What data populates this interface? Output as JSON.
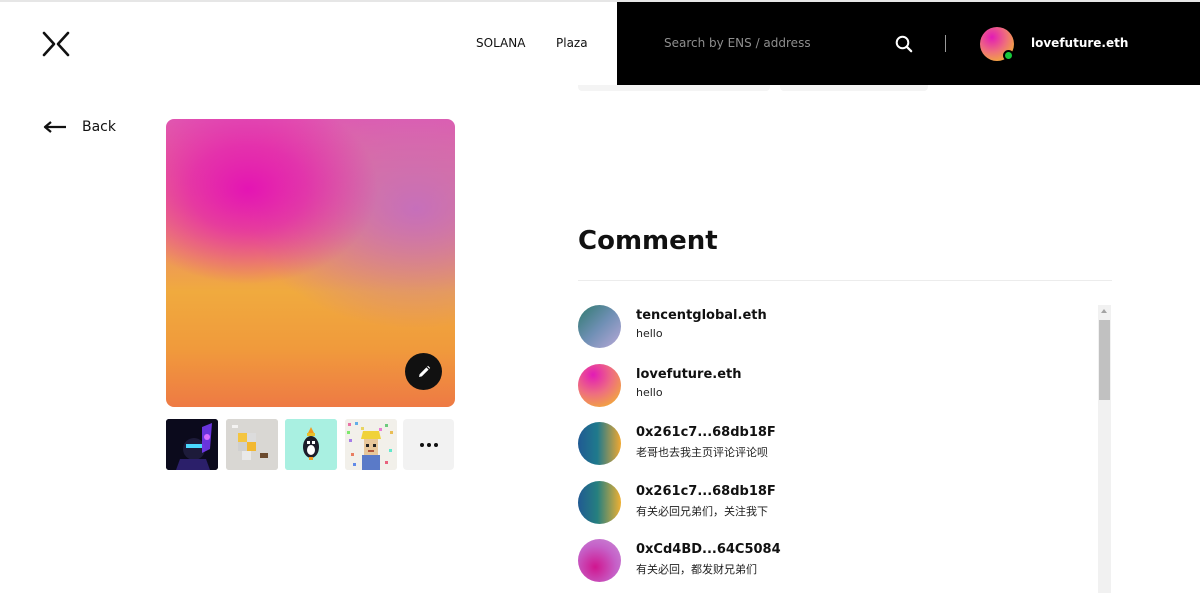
{
  "header": {
    "logo_icon": "x-logo-icon",
    "nav": [
      {
        "label": "SOLANA"
      },
      {
        "label": "Plaza"
      }
    ],
    "search": {
      "placeholder": "Search by ENS / address",
      "value": "",
      "icon": "search-icon"
    },
    "user": {
      "name": "lovefuture.eth",
      "status_color": "#17c83b"
    }
  },
  "back": {
    "label": "Back",
    "icon": "arrow-left-icon"
  },
  "nft": {
    "edit_icon": "pencil-icon",
    "thumbnails": [
      {
        "name": "thumbnail-1"
      },
      {
        "name": "thumbnail-2"
      },
      {
        "name": "thumbnail-3"
      },
      {
        "name": "thumbnail-4"
      }
    ],
    "more_icon": "more-dots-icon"
  },
  "comments": {
    "title": "Comment",
    "items": [
      {
        "name": "tencentglobal.eth",
        "text": "hello"
      },
      {
        "name": "lovefuture.eth",
        "text": "hello"
      },
      {
        "name": "0x261c7...68db18F",
        "text": "老哥也去我主页评论评论呗"
      },
      {
        "name": "0x261c7...68db18F",
        "text": "有关必回兄弟们，关注我下"
      },
      {
        "name": "0xCd4BD...64C5084",
        "text": "有关必回，都发财兄弟们"
      }
    ]
  },
  "colors": {
    "header_bg": "#000000",
    "accent_online": "#17c83b"
  }
}
